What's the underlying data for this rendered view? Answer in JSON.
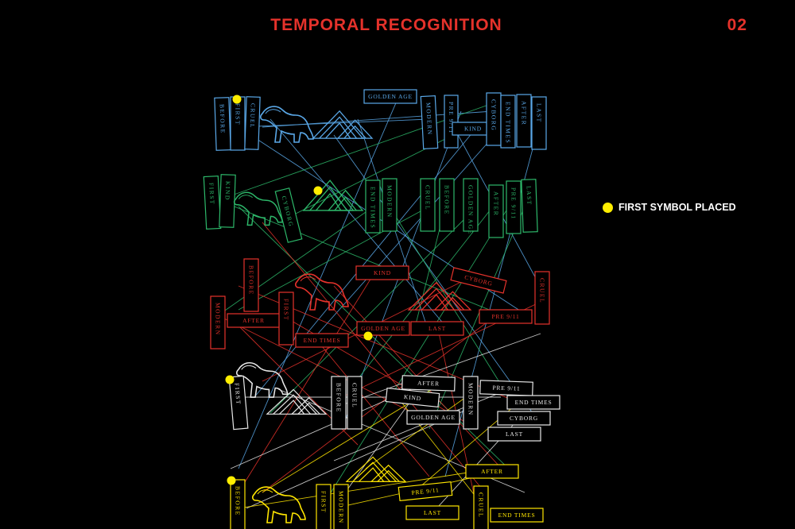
{
  "header": {
    "title": "TEMPORAL RECOGNITION",
    "page_number": "02"
  },
  "legend": {
    "label": "FIRST SYMBOL PLACED",
    "color": "#ffee00"
  },
  "colors": {
    "row1": "#5aa8e8",
    "row2": "#2db86a",
    "row3": "#e5322b",
    "row4": "#e8e8e8",
    "row5": "#ffe600"
  },
  "rows": [
    {
      "color": "#5aa8e8",
      "blocks": [
        {
          "label": "BEFORE",
          "orient": "v"
        },
        {
          "label": "FIRST",
          "orient": "v"
        },
        {
          "label": "CRUEL",
          "orient": "v"
        },
        {
          "label": "",
          "icon": "dinosaur-icon"
        },
        {
          "label": "",
          "icon": "pyramids-icon"
        },
        {
          "label": "GOLDEN AGE",
          "orient": "h"
        },
        {
          "label": "MODERN",
          "orient": "v"
        },
        {
          "label": "PRE 9/11",
          "orient": "v"
        },
        {
          "label": "KIND",
          "orient": "h"
        },
        {
          "label": "CYBORG",
          "orient": "v"
        },
        {
          "label": "END TIMES",
          "orient": "v"
        },
        {
          "label": "AFTER",
          "orient": "v"
        },
        {
          "label": "LAST",
          "orient": "v"
        }
      ]
    },
    {
      "color": "#2db86a",
      "blocks": [
        {
          "label": "FIRST",
          "orient": "v"
        },
        {
          "label": "KIND",
          "orient": "v"
        },
        {
          "label": "",
          "icon": "dinosaur-icon"
        },
        {
          "label": "CYBORG",
          "orient": "v"
        },
        {
          "label": "",
          "icon": "pyramids-icon"
        },
        {
          "label": "END TIMES",
          "orient": "v"
        },
        {
          "label": "MODERN",
          "orient": "v"
        },
        {
          "label": "CRUEL",
          "orient": "v"
        },
        {
          "label": "BEFORE",
          "orient": "v"
        },
        {
          "label": "GOLDEN AGE",
          "orient": "v"
        },
        {
          "label": "AFTER",
          "orient": "v"
        },
        {
          "label": "PRE 9/11",
          "orient": "v"
        },
        {
          "label": "LAST",
          "orient": "v"
        }
      ]
    },
    {
      "color": "#e5322b",
      "blocks": [
        {
          "label": "BEFORE",
          "orient": "v"
        },
        {
          "label": "",
          "icon": "dinosaur-icon"
        },
        {
          "label": "KIND",
          "orient": "h"
        },
        {
          "label": "CYBORG",
          "orient": "h"
        },
        {
          "label": "CRUEL",
          "orient": "v"
        },
        {
          "label": "MODERN",
          "orient": "v"
        },
        {
          "label": "AFTER",
          "orient": "h"
        },
        {
          "label": "FIRST",
          "orient": "v"
        },
        {
          "label": "",
          "icon": "pyramids-icon"
        },
        {
          "label": "PRE 9/11",
          "orient": "h"
        },
        {
          "label": "GOLDEN AGE",
          "orient": "h"
        },
        {
          "label": "LAST",
          "orient": "h"
        },
        {
          "label": "END TIMES",
          "orient": "h"
        }
      ]
    },
    {
      "color": "#e8e8e8",
      "blocks": [
        {
          "label": "",
          "icon": "dinosaur-icon"
        },
        {
          "label": "FIRST",
          "orient": "v"
        },
        {
          "label": "",
          "icon": "pyramids-icon"
        },
        {
          "label": "BEFORE",
          "orient": "v"
        },
        {
          "label": "CRUEL",
          "orient": "v"
        },
        {
          "label": "AFTER",
          "orient": "h"
        },
        {
          "label": "KIND",
          "orient": "h"
        },
        {
          "label": "GOLDEN AGE",
          "orient": "h"
        },
        {
          "label": "MODERN",
          "orient": "v"
        },
        {
          "label": "PRE 9/11",
          "orient": "h"
        },
        {
          "label": "END TIMES",
          "orient": "h"
        },
        {
          "label": "CYBORG",
          "orient": "h"
        },
        {
          "label": "LAST",
          "orient": "h"
        }
      ]
    },
    {
      "color": "#ffe600",
      "blocks": [
        {
          "label": "",
          "icon": "pyramids-icon"
        },
        {
          "label": "AFTER",
          "orient": "h"
        },
        {
          "label": "BEFORE",
          "orient": "v"
        },
        {
          "label": "",
          "icon": "dinosaur-icon"
        },
        {
          "label": "FIRST",
          "orient": "v"
        },
        {
          "label": "MODERN",
          "orient": "v"
        },
        {
          "label": "PRE 9/11",
          "orient": "h"
        },
        {
          "label": "LAST",
          "orient": "h"
        },
        {
          "label": "CRUEL",
          "orient": "v"
        },
        {
          "label": "END TIMES",
          "orient": "h"
        }
      ]
    }
  ]
}
